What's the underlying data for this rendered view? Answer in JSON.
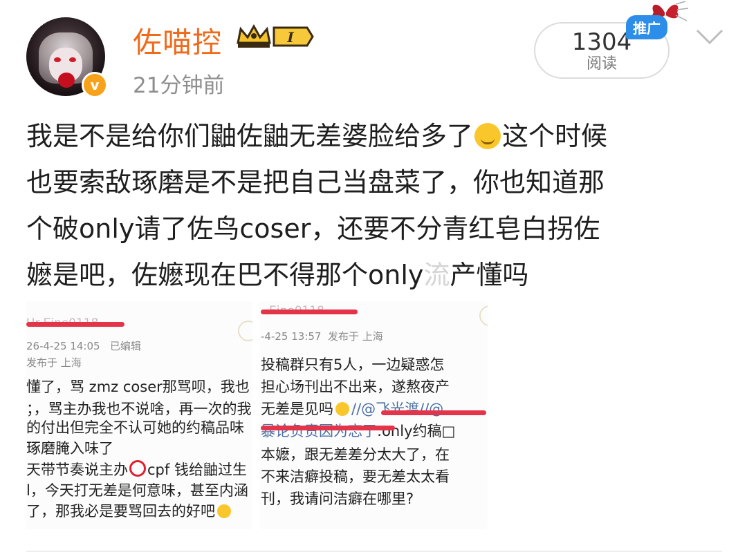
{
  "post": {
    "username": "佐喵控",
    "timestamp": "21分钟前",
    "level_badge": "I",
    "verified_badge": "v",
    "reads_count": "1304",
    "reads_label": "阅读",
    "promo_label": "推广",
    "text_lines": [
      "我是不是给你们鼬佐鼬无差婆脸给多了",
      "这个时候",
      "也要索敌琢磨是不是把自己当盘菜了，你也知道那",
      "个破only请了佐鸟coser，还要不分青红皂白拐佐",
      "嬷是吧，佐嬷现在巴不得那个only",
      "产懂吗"
    ],
    "text_obscured": "流"
  },
  "screenshot1": {
    "name_struck": "Ur-Eine0118",
    "meta_date": "26-4-25 14:05",
    "meta_edited": "已编辑",
    "meta_location": "发布于 上海",
    "lines": [
      "懂了，骂 zmz coser那骂呗，我也",
      "；，骂主办我也不说啥，再一次的我",
      "的付出但完全不认可她的约稿品味",
      "琢磨腌入味了",
      "天带节奏说主办",
      "cpf 钱给鼬过生",
      "l，今天打无差是何意味，甚至内涵",
      "了，那我必是要骂回去的好吧"
    ]
  },
  "screenshot2": {
    "name_struck": "Eine0118",
    "meta_date": "-4-25 13:57",
    "meta_location": "发布于 上海",
    "lines": [
      "投稿群只有5人，一边疑惑怎",
      "担心场刊出不出来，遂熬夜产",
      "无差是见吗",
      "//@飞光渡//@",
      "暴论负责因为忘了",
      ":only约稿□",
      "本嬷，跟无差差分太大了，在",
      "不来洁癖投稿，要无差太太看",
      "刊，我请问洁癖在哪里?"
    ]
  },
  "colors": {
    "username": "#f06a1a",
    "promo": "#2c8ee8",
    "strike": "#e4344a",
    "verified": "#f7a21a"
  },
  "icons": [
    "avatar-image",
    "verified-icon",
    "crown-level-icon",
    "butterfly-icon",
    "chevron-down-icon",
    "grin-sweat-emoji",
    "joy-emoji",
    "red-circle-emoji"
  ]
}
